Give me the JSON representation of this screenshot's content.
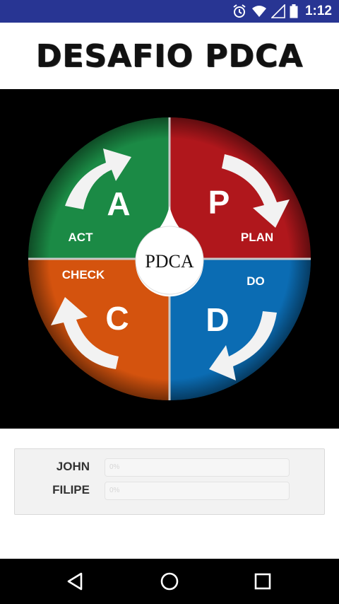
{
  "status_bar": {
    "time": "1:12",
    "icons": [
      "alarm-icon",
      "wifi-icon",
      "signal-icon",
      "battery-icon"
    ],
    "background": "#283593"
  },
  "header": {
    "title": "DESAFIO PDCA"
  },
  "pdca": {
    "center_label": "PDCA",
    "quadrants": {
      "plan": {
        "letter": "P",
        "label": "PLAN",
        "color": "#b0171c"
      },
      "do": {
        "letter": "D",
        "label": "DO",
        "color": "#0b6cb3"
      },
      "check": {
        "letter": "C",
        "label": "CHECK",
        "color": "#d4530e"
      },
      "act": {
        "letter": "A",
        "label": "ACT",
        "color": "#1b8a45"
      }
    }
  },
  "players": [
    {
      "name": "JOHN",
      "progress_text": "0%",
      "progress": 0
    },
    {
      "name": "FILIPE",
      "progress_text": "0%",
      "progress": 0
    }
  ],
  "nav": {
    "icons": [
      "back-icon",
      "home-icon",
      "recents-icon"
    ]
  }
}
